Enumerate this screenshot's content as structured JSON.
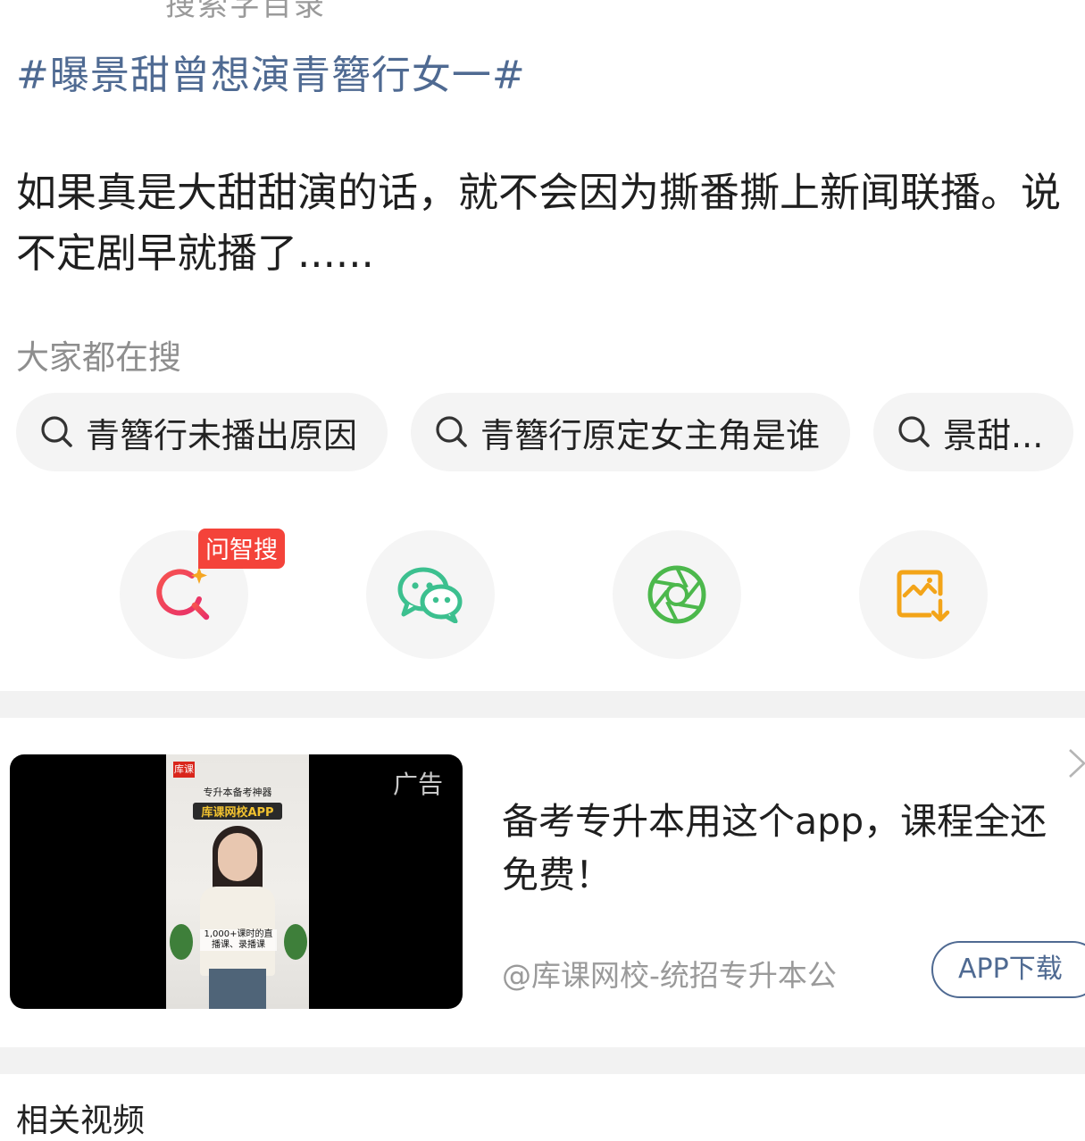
{
  "top_cut_text": "搜索字目录",
  "hashtag": "#曝景甜曾想演青簪行女一#",
  "body_text": "如果真是大甜甜演的话，就不会因为撕番撕上新闻联播。说不定剧早就播了......",
  "search_section": {
    "label": "大家都在搜",
    "chips": [
      {
        "text": "青簪行未播出原因",
        "icon": "search-icon"
      },
      {
        "text": "青簪行原定女主角是谁",
        "icon": "search-icon"
      },
      {
        "text": "景甜...",
        "icon": "search-icon"
      }
    ]
  },
  "share": {
    "badge": "问智搜",
    "buttons": [
      {
        "name": "ai-search",
        "icon": "ai-search-icon",
        "color": "#f04a4a"
      },
      {
        "name": "wechat",
        "icon": "wechat-icon",
        "color": "#3cc08f"
      },
      {
        "name": "moments",
        "icon": "moments-aperture-icon",
        "color": "#4cb84c"
      },
      {
        "name": "save-image",
        "icon": "image-download-icon",
        "color": "#f3a418"
      }
    ]
  },
  "ad": {
    "label": "广告",
    "title": "备考专升本用这个app，课程全还免费！",
    "source": "@库课网校-统招专升本公",
    "button": "APP下载",
    "thumb": {
      "logo": "库课",
      "line1": "专升本备考神器",
      "line2": "库课网校APP",
      "caption": "1,000+课时的直播课、录播课"
    }
  },
  "related_title": "相关视频",
  "colors": {
    "hashtag": "#4f6a92",
    "badge": "#f4433a",
    "divider": "#f2f2f2"
  }
}
